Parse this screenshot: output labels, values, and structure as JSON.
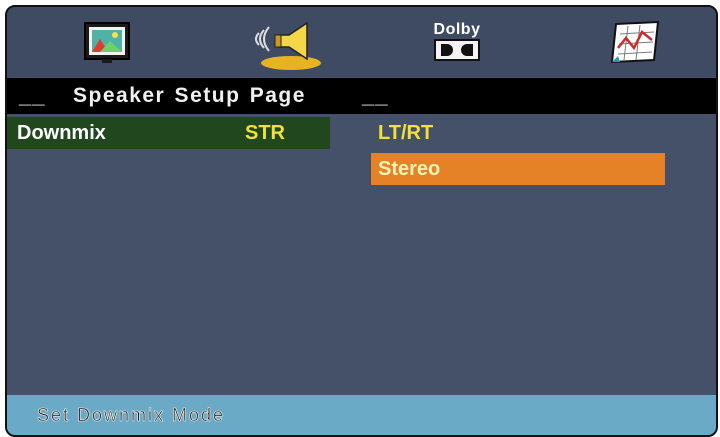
{
  "icons": [
    {
      "name": "picture-setup-icon"
    },
    {
      "name": "speaker-setup-icon",
      "selected": true
    },
    {
      "name": "dolby-setup-icon",
      "label": "Dolby"
    },
    {
      "name": "preference-setup-icon"
    }
  ],
  "title": {
    "prefix": "__",
    "text": "Speaker Setup Page",
    "suffix": "__"
  },
  "setting": {
    "label": "Downmix",
    "value": "STR"
  },
  "options": [
    {
      "label": "LT/RT",
      "highlighted": false
    },
    {
      "label": "Stereo",
      "highlighted": true
    }
  ],
  "status": {
    "text": "Set Downmix Mode"
  },
  "colors": {
    "panel": "#455069",
    "title_bar": "#000000",
    "selected_row": "#21471f",
    "highlight": "#e58227",
    "value_text": "#f4e03a",
    "status_bar": "#6aaac6"
  }
}
